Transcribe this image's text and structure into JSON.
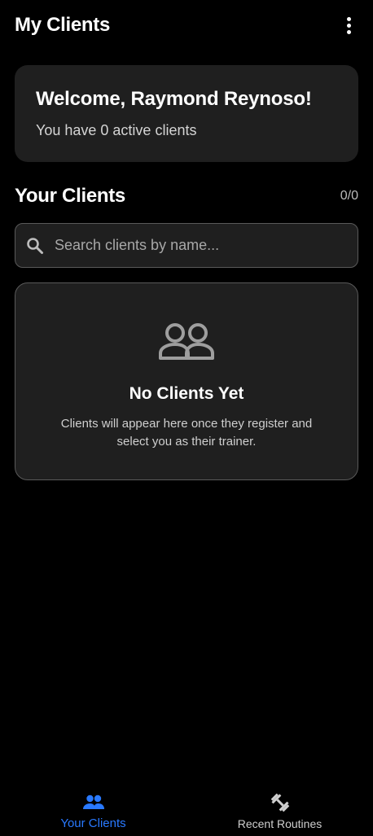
{
  "app_bar": {
    "title": "My Clients",
    "more_icon": "more-vert-icon"
  },
  "welcome": {
    "title": "Welcome, Raymond Reynoso!",
    "subtitle": "You have 0 active clients"
  },
  "clients_section": {
    "title": "Your Clients",
    "count": "0/0"
  },
  "search": {
    "icon": "search-icon",
    "placeholder": "Search clients by name...",
    "value": ""
  },
  "empty_state": {
    "icon": "people-outline-icon",
    "title": "No Clients Yet",
    "description": "Clients will appear here once they register and select you as their trainer."
  },
  "bottom_nav": {
    "items": [
      {
        "label": "Your Clients",
        "icon": "people-icon",
        "active": true
      },
      {
        "label": "Recent Routines",
        "icon": "fitness-dumbbell-icon",
        "active": false
      }
    ]
  },
  "colors": {
    "background": "#000000",
    "card": "#1f1f1f",
    "accent": "#2979ff",
    "border": "#5a5a5a",
    "muted_icon": "#9e9e9e"
  }
}
